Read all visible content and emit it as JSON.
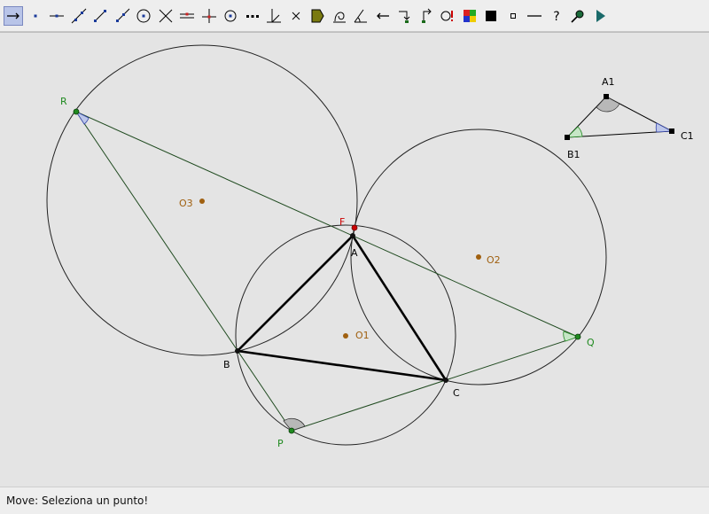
{
  "toolbar": {
    "tools": [
      {
        "name": "move-tool-icon",
        "active": true
      },
      {
        "name": "new-point-icon"
      },
      {
        "name": "point-on-object-icon"
      },
      {
        "name": "line-through-two-points-icon"
      },
      {
        "name": "segment-icon"
      },
      {
        "name": "ray-icon"
      },
      {
        "name": "circle-icon"
      },
      {
        "name": "intersect-icon"
      },
      {
        "name": "parallel-line-icon"
      },
      {
        "name": "perpendicular-line-icon"
      },
      {
        "name": "midpoint-icon"
      },
      {
        "name": "dotted-line-icon"
      },
      {
        "name": "angle-bisector-icon"
      },
      {
        "name": "delete-icon"
      },
      {
        "name": "polygon-icon"
      },
      {
        "name": "locus-icon"
      },
      {
        "name": "angle-icon"
      },
      {
        "name": "arrow-left-icon"
      },
      {
        "name": "translate-icon"
      },
      {
        "name": "rotate-icon"
      },
      {
        "name": "macro-icon"
      },
      {
        "name": "color-palette-icon"
      },
      {
        "name": "filled-square-icon"
      },
      {
        "name": "small-square-icon"
      },
      {
        "name": "line-style-icon"
      },
      {
        "name": "help-icon"
      },
      {
        "name": "magnifier-icon"
      },
      {
        "name": "play-icon"
      }
    ]
  },
  "labels": {
    "R": "R",
    "F": "F",
    "A": "A",
    "B": "B",
    "C": "C",
    "P": "P",
    "Q": "Q",
    "O1": "O1",
    "O2": "O2",
    "O3": "O3",
    "A1": "A1",
    "B1": "B1",
    "C1": "C1"
  },
  "colors": {
    "line": "#1f4a1f",
    "triangle": "#000000",
    "center": "#a06010",
    "green_point": "#1f8a1f",
    "red_point": "#cc0000"
  },
  "status": {
    "text": "Move: Seleziona un punto!"
  }
}
